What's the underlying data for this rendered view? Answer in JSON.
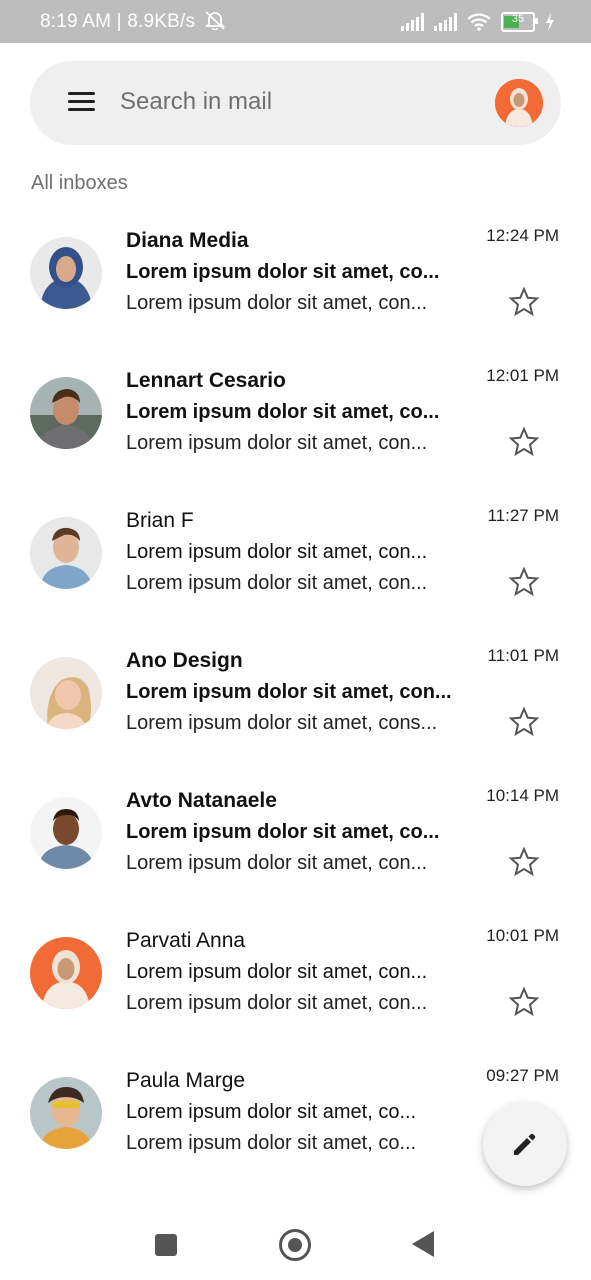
{
  "status_bar": {
    "left_text": "8:19 AM | 8.9KB/s",
    "battery": "35",
    "icons": [
      "mute-icon",
      "signal-icon",
      "signal-icon",
      "wifi-icon",
      "battery-icon",
      "charging-icon"
    ]
  },
  "search": {
    "placeholder": "Search in mail",
    "menu_icon": "menu-icon",
    "profile_icon": "avatar"
  },
  "section_label": "All inboxes",
  "mails": [
    {
      "sender": "Diana Media",
      "subject": "Lorem ipsum dolor sit amet, co...",
      "preview": "Lorem ipsum dolor sit amet, con...",
      "time": "12:24 PM",
      "unread": true
    },
    {
      "sender": "Lennart Cesario",
      "subject": "Lorem ipsum dolor sit amet, co...",
      "preview": "Lorem ipsum dolor sit amet, con...",
      "time": "12:01 PM",
      "unread": true
    },
    {
      "sender": "Brian F",
      "subject": "Lorem ipsum dolor sit amet, con...",
      "preview": "Lorem ipsum dolor sit amet, con...",
      "time": "11:27 PM",
      "unread": false
    },
    {
      "sender": "Ano Design",
      "subject": "Lorem ipsum dolor sit amet, con...",
      "preview": "Lorem ipsum dolor sit amet, cons...",
      "time": "11:01 PM",
      "unread": true
    },
    {
      "sender": "Avto Natanaele",
      "subject": "Lorem ipsum dolor sit amet, co...",
      "preview": "Lorem ipsum dolor sit amet, con...",
      "time": "10:14 PM",
      "unread": true
    },
    {
      "sender": "Parvati Anna",
      "subject": "Lorem ipsum dolor sit amet, con...",
      "preview": "Lorem ipsum dolor sit amet, con...",
      "time": "10:01 PM",
      "unread": false
    },
    {
      "sender": "Paula Marge",
      "subject": "Lorem ipsum dolor sit amet, co...",
      "preview": "Lorem ipsum dolor sit amet, co...",
      "time": "09:27 PM",
      "unread": false
    }
  ],
  "fab": {
    "icon": "edit-icon"
  },
  "colors": {
    "status_bar": "#bdbdbd",
    "search_bg": "#efefef",
    "accent_avatar": "#f26a36",
    "battery_fill": "#4caf50"
  }
}
